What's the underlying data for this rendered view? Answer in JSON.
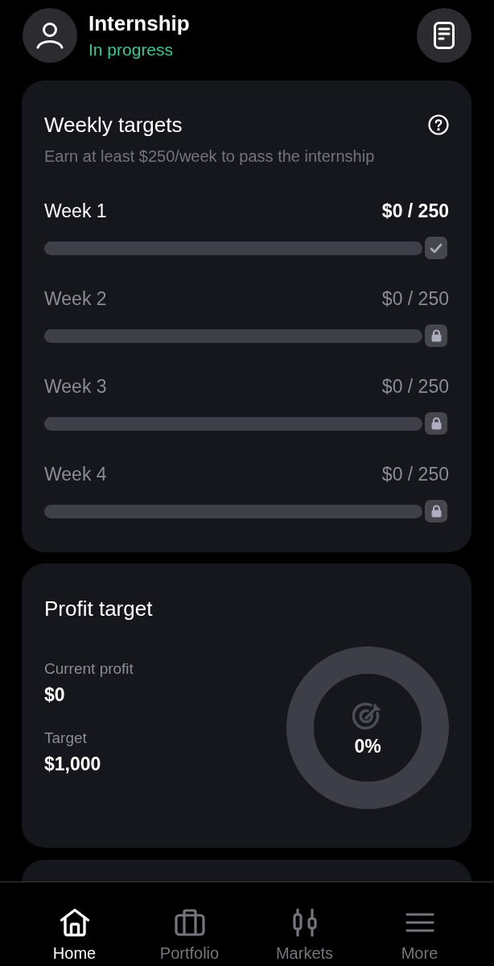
{
  "header": {
    "title": "Internship",
    "status": "In progress"
  },
  "weekly_targets": {
    "title": "Weekly targets",
    "subtitle": "Earn at least $250/week to pass the internship",
    "weeks": [
      {
        "label": "Week 1",
        "amount": "$0 / 250",
        "locked": false,
        "level": 0
      },
      {
        "label": "Week 2",
        "amount": "$0 / 250",
        "locked": true,
        "level": 0
      },
      {
        "label": "Week 3",
        "amount": "$0 / 250",
        "locked": true,
        "level": 0
      },
      {
        "label": "Week 4",
        "amount": "$0 / 250",
        "locked": true,
        "level": 0
      }
    ]
  },
  "profit_target": {
    "title": "Profit target",
    "stats": [
      {
        "label": "Current profit",
        "value": "$0"
      },
      {
        "label": "Target",
        "value": "$1,000"
      }
    ],
    "progress": {
      "percent": "0%"
    }
  },
  "nav": [
    {
      "label": "Home",
      "selected": true
    },
    {
      "label": "Portfolio",
      "selected": false
    },
    {
      "label": "Markets",
      "selected": false
    },
    {
      "label": "More",
      "selected": false
    }
  ]
}
